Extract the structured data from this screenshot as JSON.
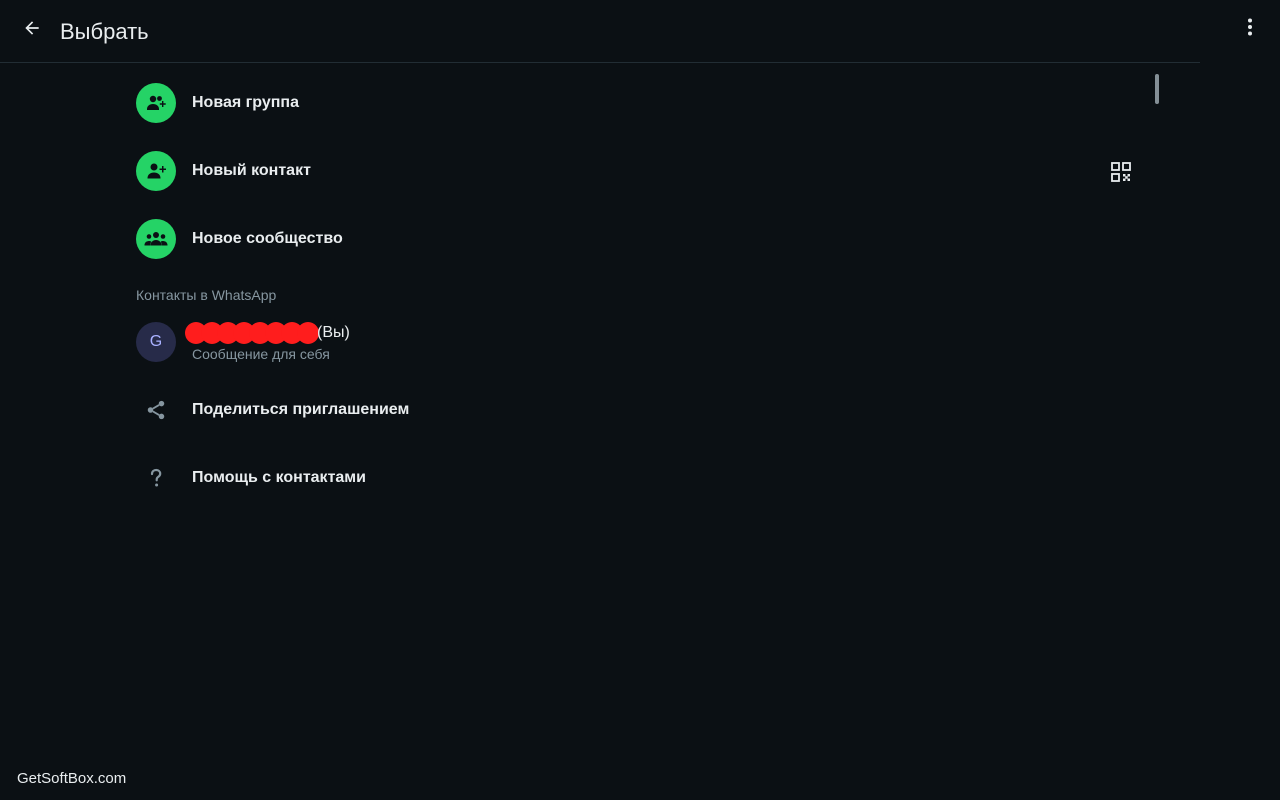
{
  "header": {
    "title": "Выбрать",
    "back_icon": "arrow-left-icon",
    "menu_icon": "more-vertical-icon"
  },
  "actions": [
    {
      "label": "Новая группа",
      "icon": "add-group-icon"
    },
    {
      "label": "Новый контакт",
      "icon": "add-contact-icon",
      "trailing_icon": "qr-code-icon"
    },
    {
      "label": "Новое сообщество",
      "icon": "community-icon"
    }
  ],
  "contacts_section": {
    "label": "Контакты в WhatsApp",
    "self_contact": {
      "avatar_letter": "G",
      "name_suffix": "(Вы)",
      "subtitle": "Сообщение для себя"
    }
  },
  "extra_actions": [
    {
      "label": "Поделиться приглашением",
      "icon": "share-icon"
    },
    {
      "label": "Помощь с контактами",
      "icon": "help-icon"
    }
  ],
  "watermark": "GetSoftBox.com",
  "colors": {
    "background": "#0b1014",
    "accent_green": "#25d366",
    "text_primary": "#e9edef",
    "text_secondary": "#8696a0",
    "redaction": "#ff1d1d"
  }
}
